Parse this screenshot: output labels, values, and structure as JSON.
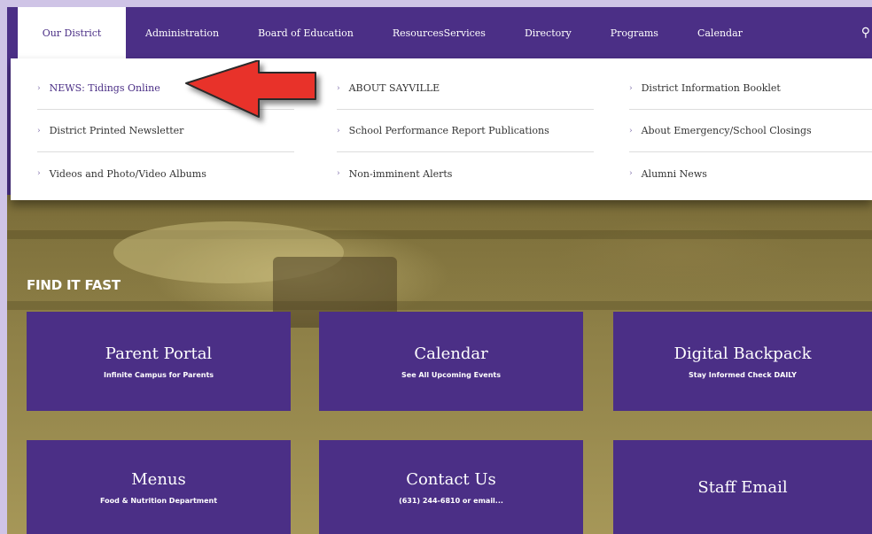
{
  "nav": {
    "items": [
      {
        "label": "Our District"
      },
      {
        "label": "Administration"
      },
      {
        "label": "Board of Education"
      },
      {
        "label": "ResourcesServices"
      },
      {
        "label": "Directory"
      },
      {
        "label": "Programs"
      },
      {
        "label": "Calendar"
      }
    ]
  },
  "dropdown": {
    "col1": [
      {
        "label": "NEWS: Tidings Online"
      },
      {
        "label": "District Printed Newsletter"
      },
      {
        "label": "Videos and Photo/Video Albums"
      }
    ],
    "col2": [
      {
        "label": "ABOUT SAYVILLE"
      },
      {
        "label": "School Performance Report Publications"
      },
      {
        "label": "Non-imminent Alerts"
      }
    ],
    "col3": [
      {
        "label": "District Information Booklet"
      },
      {
        "label": "About Emergency/School Closings"
      },
      {
        "label": "Alumni News"
      }
    ]
  },
  "find_it_fast": {
    "title": "FIND IT FAST",
    "tiles": [
      {
        "title": "Parent Portal",
        "subtitle": "Infinite Campus for Parents"
      },
      {
        "title": "Calendar",
        "subtitle": "See All Upcoming Events"
      },
      {
        "title": "Digital Backpack",
        "subtitle": "Stay Informed Check DAILY"
      },
      {
        "title": "Menus",
        "subtitle": "Food & Nutrition Department"
      },
      {
        "title": "Contact Us",
        "subtitle": "(631) 244-6810 or email..."
      },
      {
        "title": "Staff Email",
        "subtitle": ""
      }
    ]
  },
  "colors": {
    "brand_purple": "#4b2f86",
    "annotation_red": "#e8322a"
  }
}
